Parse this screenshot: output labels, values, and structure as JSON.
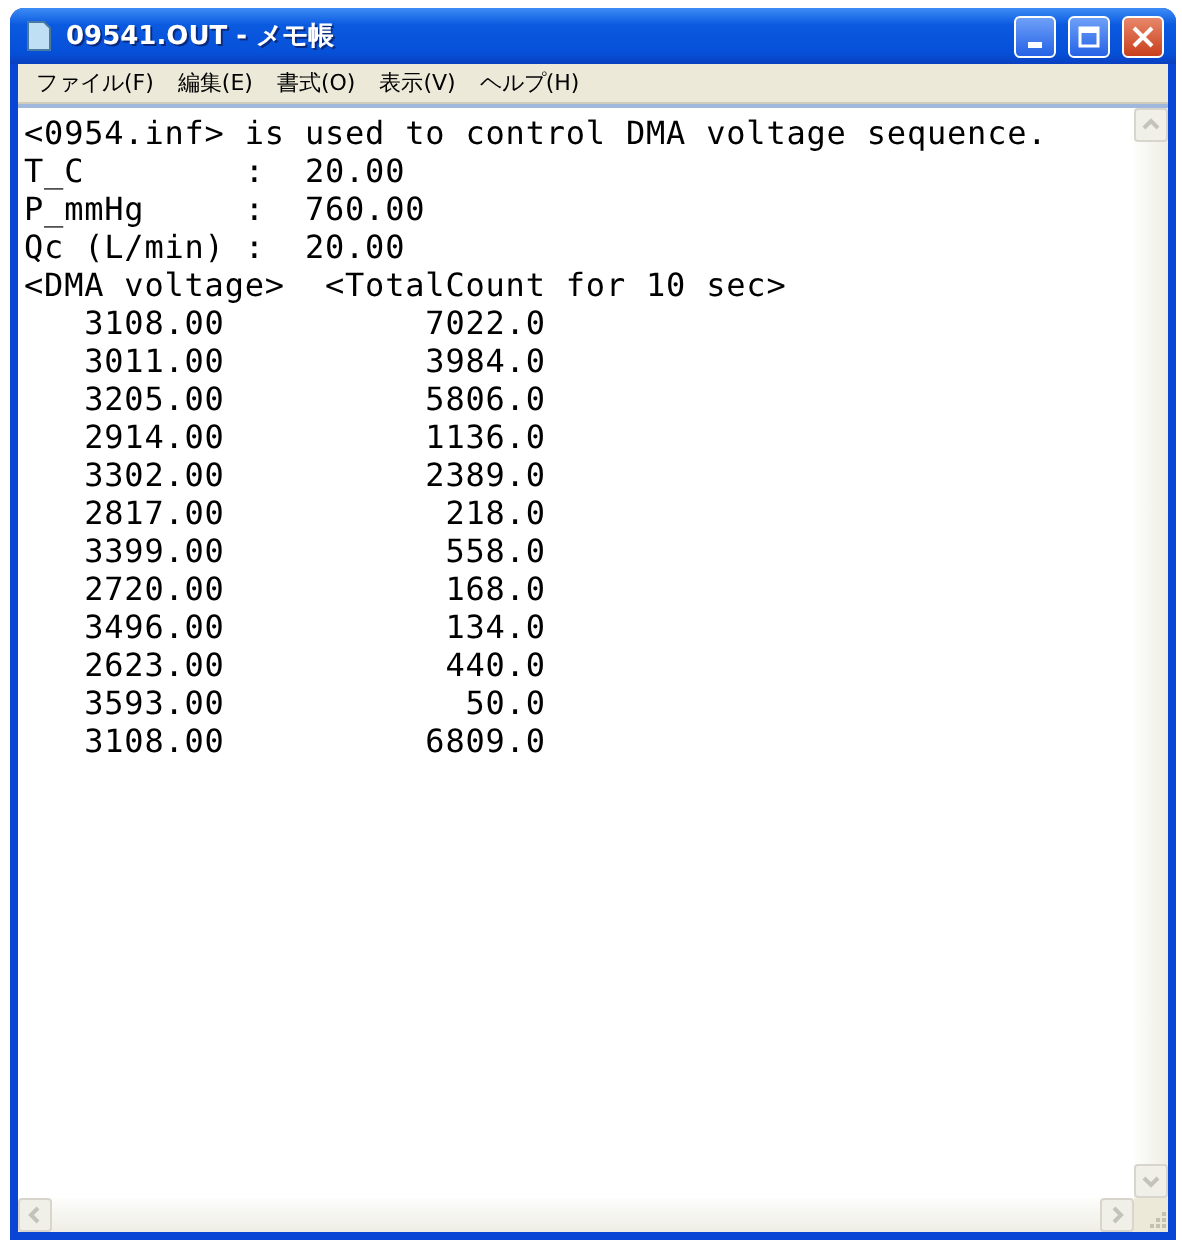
{
  "window": {
    "title": "09541.OUT - メモ帳"
  },
  "menu": [
    "ファイル(F)",
    "編集(E)",
    "書式(O)",
    "表示(V)",
    "ヘルプ(H)"
  ],
  "lines": [
    "<0954.inf> is used to control DMA voltage sequence.",
    "T_C        :  20.00",
    "P_mmHg     :  760.00",
    "Qc (L/min) :  20.00",
    "<DMA voltage>  <TotalCount for 10 sec>",
    "   3108.00          7022.0",
    "   3011.00          3984.0",
    "   3205.00          5806.0",
    "   2914.00          1136.0",
    "   3302.00          2389.0",
    "   2817.00           218.0",
    "   3399.00           558.0",
    "   2720.00           168.0",
    "   3496.00           134.0",
    "   2623.00           440.0",
    "   3593.00            50.0",
    "   3108.00          6809.0"
  ]
}
